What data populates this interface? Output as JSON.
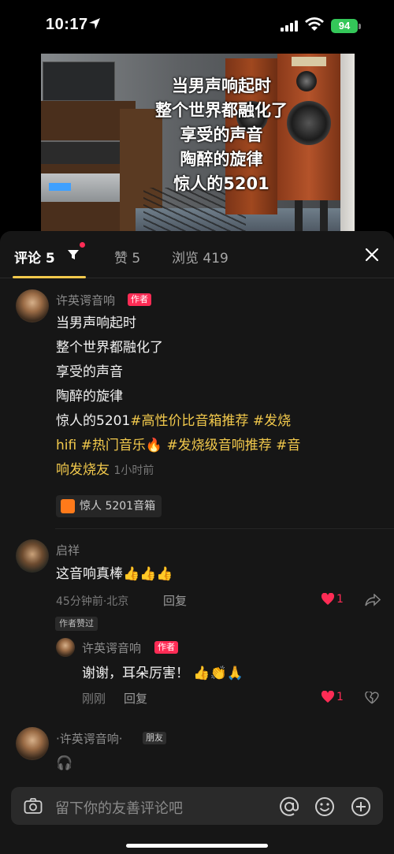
{
  "status_bar": {
    "time": "10:17",
    "battery": "94",
    "location_icon": "location-arrow-icon"
  },
  "video": {
    "lyrics": [
      "当男声响起时",
      "整个世界都融化了",
      "享受的声音",
      "陶醉的旋律",
      "惊人的5201"
    ]
  },
  "tabs": [
    {
      "label": "评论 5",
      "active": true
    },
    {
      "label": "赞 5",
      "active": false
    },
    {
      "label": "浏览 419",
      "active": false
    }
  ],
  "post": {
    "author": "许英谔音响",
    "author_tag": "作者",
    "lines": [
      "当男声响起时",
      "整个世界都融化了",
      "享受的声音",
      "陶醉的旋律"
    ],
    "line5_prefix": "惊人的5201",
    "tag1": "#高性价比音箱推荐",
    "tag2": "#发烧",
    "tag2b": "hifi",
    "tag3": "#热门音乐",
    "tag4": "#发烧级音响推荐",
    "tag5a": "#音",
    "tag5b": "响发烧友",
    "time": "1小时前",
    "product": "惊人 5201音箱"
  },
  "comments": [
    {
      "user": "启祥",
      "text": "这音响真棒",
      "emoji": "👍👍👍",
      "meta": "45分钟前·北京",
      "reply": "回复",
      "likes": "1",
      "liked_by_author": "作者赞过",
      "replies": [
        {
          "user": "许英谔音响",
          "tag": "作者",
          "text": "谢谢，耳朵厉害！",
          "emoji": "👍👏🙏",
          "meta": "刚刚",
          "reply": "回复",
          "likes": "1"
        }
      ]
    },
    {
      "user": "·许英谔音响·",
      "tag": "朋友",
      "text": "🎧"
    }
  ],
  "input": {
    "placeholder": "留下你的友善评论吧"
  },
  "colors": {
    "accent": "#f2c94c",
    "like": "#fe2c55",
    "sheet_bg": "#161616"
  }
}
